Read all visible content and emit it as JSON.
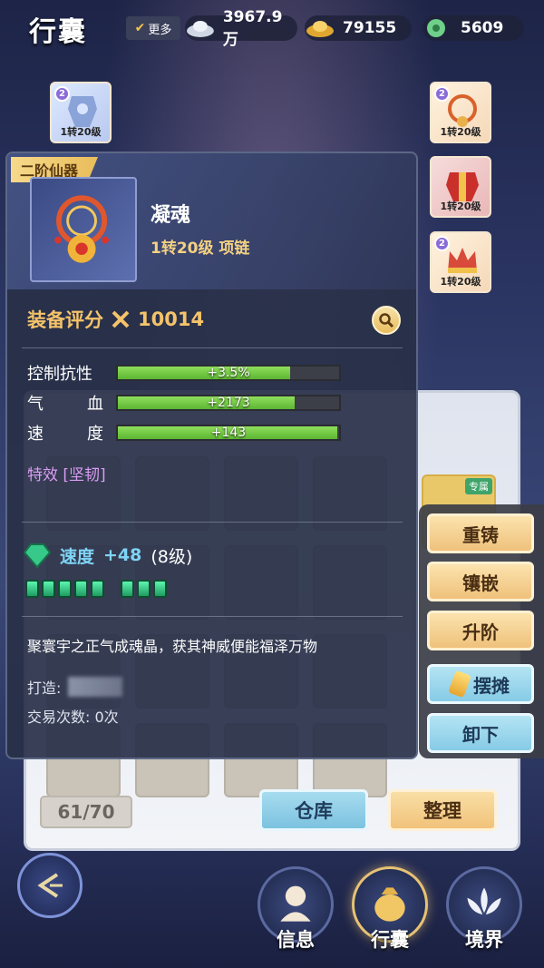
{
  "header": {
    "title": "行囊",
    "more_label": "更多",
    "currencies": [
      {
        "icon": "silver-ingot-icon",
        "value": "3967.9万"
      },
      {
        "icon": "gold-ingot-icon",
        "value": "79155"
      },
      {
        "icon": "jade-coin-icon",
        "value": "5609"
      }
    ]
  },
  "equipped": {
    "left": [
      {
        "badge": "2",
        "level": "1转20级"
      }
    ],
    "right": [
      {
        "badge": "2",
        "level": "1转20级"
      },
      {
        "badge": "",
        "level": "1转20级"
      },
      {
        "badge": "2",
        "level": "1转20级"
      }
    ]
  },
  "item": {
    "tier": "二阶仙器",
    "name": "凝魂",
    "sub": "1转20级 项链",
    "score_label": "装备评分",
    "score_value": "10014",
    "stats": [
      {
        "label_a": "控制抗性",
        "label_b": "",
        "value": "+3.5%",
        "fill": 0.78
      },
      {
        "label_a": "气",
        "label_b": "血",
        "value": "+2173",
        "fill": 0.8
      },
      {
        "label_a": "速",
        "label_b": "度",
        "value": "+143",
        "fill": 0.99
      }
    ],
    "effect": "特效 [坚韧]",
    "gem_name": "速度",
    "gem_value": "+48",
    "gem_level": "(8级)",
    "gem_pips": 8,
    "description": "聚寰宇之正气成魂晶，获其神威便能福泽万物",
    "maker_label": "打造:",
    "trade_label": "交易次数: 0次"
  },
  "inventory": {
    "capacity": "61/70",
    "warehouse_label": "仓库",
    "sort_label": "整理",
    "exclusive_label": "专属"
  },
  "actions": {
    "recast": "重铸",
    "inlay": "镶嵌",
    "upgrade": "升阶",
    "stall": "摆摊",
    "unequip": "卸下"
  },
  "nav": {
    "info": "信息",
    "bag": "行囊",
    "realm": "境界"
  },
  "colors": {
    "accent_gold": "#f4c36a",
    "stat_green": "#5cb631",
    "effect_purple": "#d89cf2",
    "gem_blue": "#7fd4f5"
  }
}
